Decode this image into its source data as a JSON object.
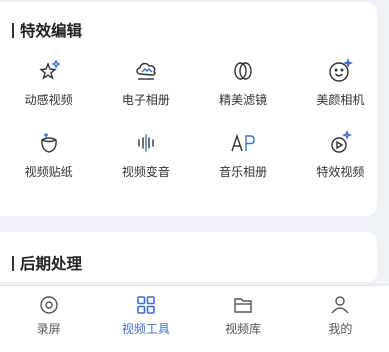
{
  "sections": {
    "effects": {
      "title": "特效编辑",
      "tools": [
        {
          "label": "动感视频",
          "icon": "sparkle-stars-icon"
        },
        {
          "label": "电子相册",
          "icon": "cloud-album-icon"
        },
        {
          "label": "精美滤镜",
          "icon": "filter-rings-icon"
        },
        {
          "label": "美颜相机",
          "icon": "smiley-face-icon"
        },
        {
          "label": "视频贴纸",
          "icon": "sticker-icon"
        },
        {
          "label": "视频变音",
          "icon": "soundwave-icon"
        },
        {
          "label": "音乐相册",
          "icon": "music-text-icon"
        },
        {
          "label": "特效视频",
          "icon": "effect-video-icon"
        }
      ]
    },
    "post": {
      "title": "后期处理"
    }
  },
  "tabbar": {
    "tabs": [
      {
        "label": "录屏",
        "icon": "record-icon",
        "active": false
      },
      {
        "label": "视频工具",
        "icon": "tools-grid-icon",
        "active": true
      },
      {
        "label": "视频库",
        "icon": "folder-icon",
        "active": false
      },
      {
        "label": "我的",
        "icon": "person-icon",
        "active": false
      }
    ]
  },
  "colors": {
    "accent": "#3b6ed9",
    "icon": "#333333",
    "icon_blue": "#3b6ed9"
  }
}
